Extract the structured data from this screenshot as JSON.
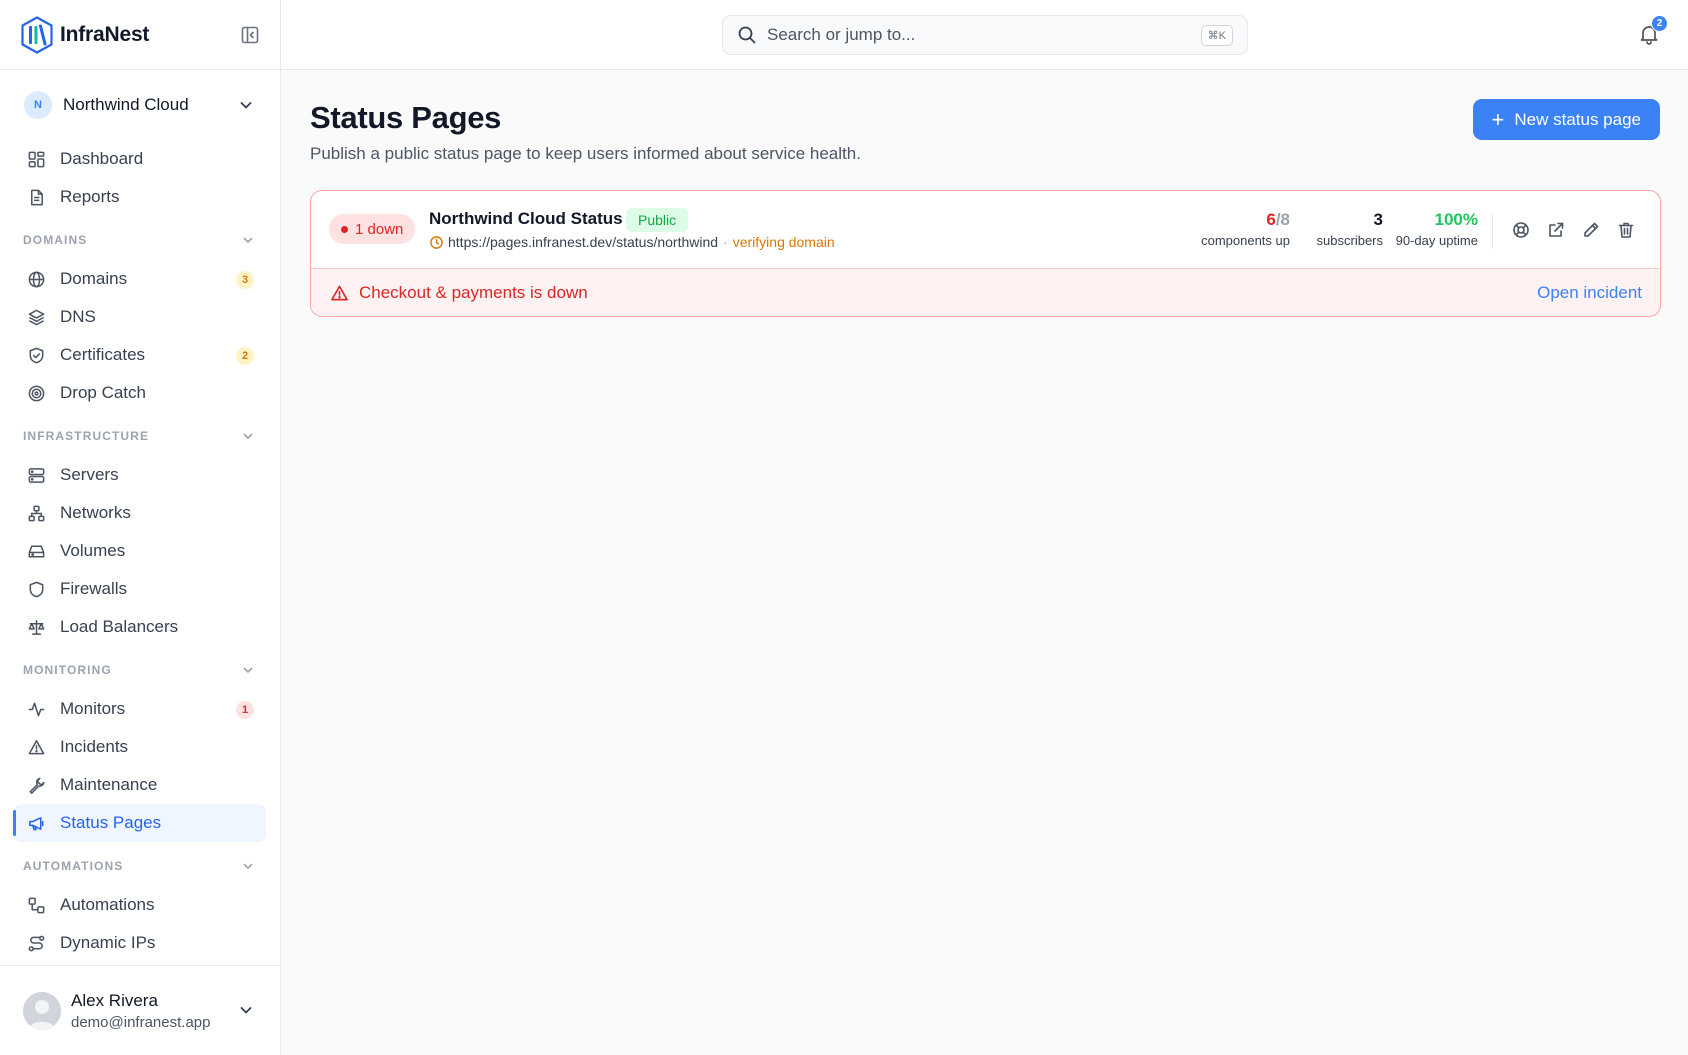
{
  "brand": {
    "name": "InfraNest"
  },
  "org": {
    "initial": "N",
    "name": "Northwind Cloud"
  },
  "nav": {
    "dashboard": "Dashboard",
    "reports": "Reports",
    "domains_section": "DOMAINS",
    "domains": {
      "label": "Domains",
      "badge": "3"
    },
    "dns": "DNS",
    "certificates": {
      "label": "Certificates",
      "badge": "2"
    },
    "drop_catch": "Drop Catch",
    "infrastructure_section": "INFRASTRUCTURE",
    "servers": "Servers",
    "networks": "Networks",
    "volumes": "Volumes",
    "firewalls": "Firewalls",
    "load_balancers": "Load Balancers",
    "monitoring_section": "MONITORING",
    "monitors": {
      "label": "Monitors",
      "badge": "1"
    },
    "incidents": "Incidents",
    "maintenance": "Maintenance",
    "status_pages": "Status Pages",
    "automations_section": "AUTOMATIONS",
    "automations": "Automations",
    "dynamic_ips": "Dynamic IPs"
  },
  "user": {
    "name": "Alex Rivera",
    "email": "demo@infranest.app"
  },
  "search": {
    "placeholder": "Search or jump to...",
    "shortcut": "⌘K"
  },
  "notifications": {
    "count": "2"
  },
  "page": {
    "title": "Status Pages",
    "subtitle": "Publish a public status page to keep users informed about service health.",
    "new_button": "New status page"
  },
  "status_page": {
    "state": "1 down",
    "name": "Northwind Cloud Status",
    "visibility": "Public",
    "url": "https://pages.infranest.dev/status/northwind",
    "separator": "·",
    "domain_state": "verifying domain",
    "components_up": "6",
    "components_total": "/8",
    "components_label": "components up",
    "subscribers": "3",
    "subscribers_label": "subscribers",
    "uptime": "100%",
    "uptime_label": "90-day uptime",
    "alert": "Checkout & payments is down",
    "alert_action": "Open incident"
  },
  "colors": {
    "accent": "#3b82f6",
    "danger": "#dc2626",
    "success": "#22c55e",
    "warning": "#d97706"
  }
}
